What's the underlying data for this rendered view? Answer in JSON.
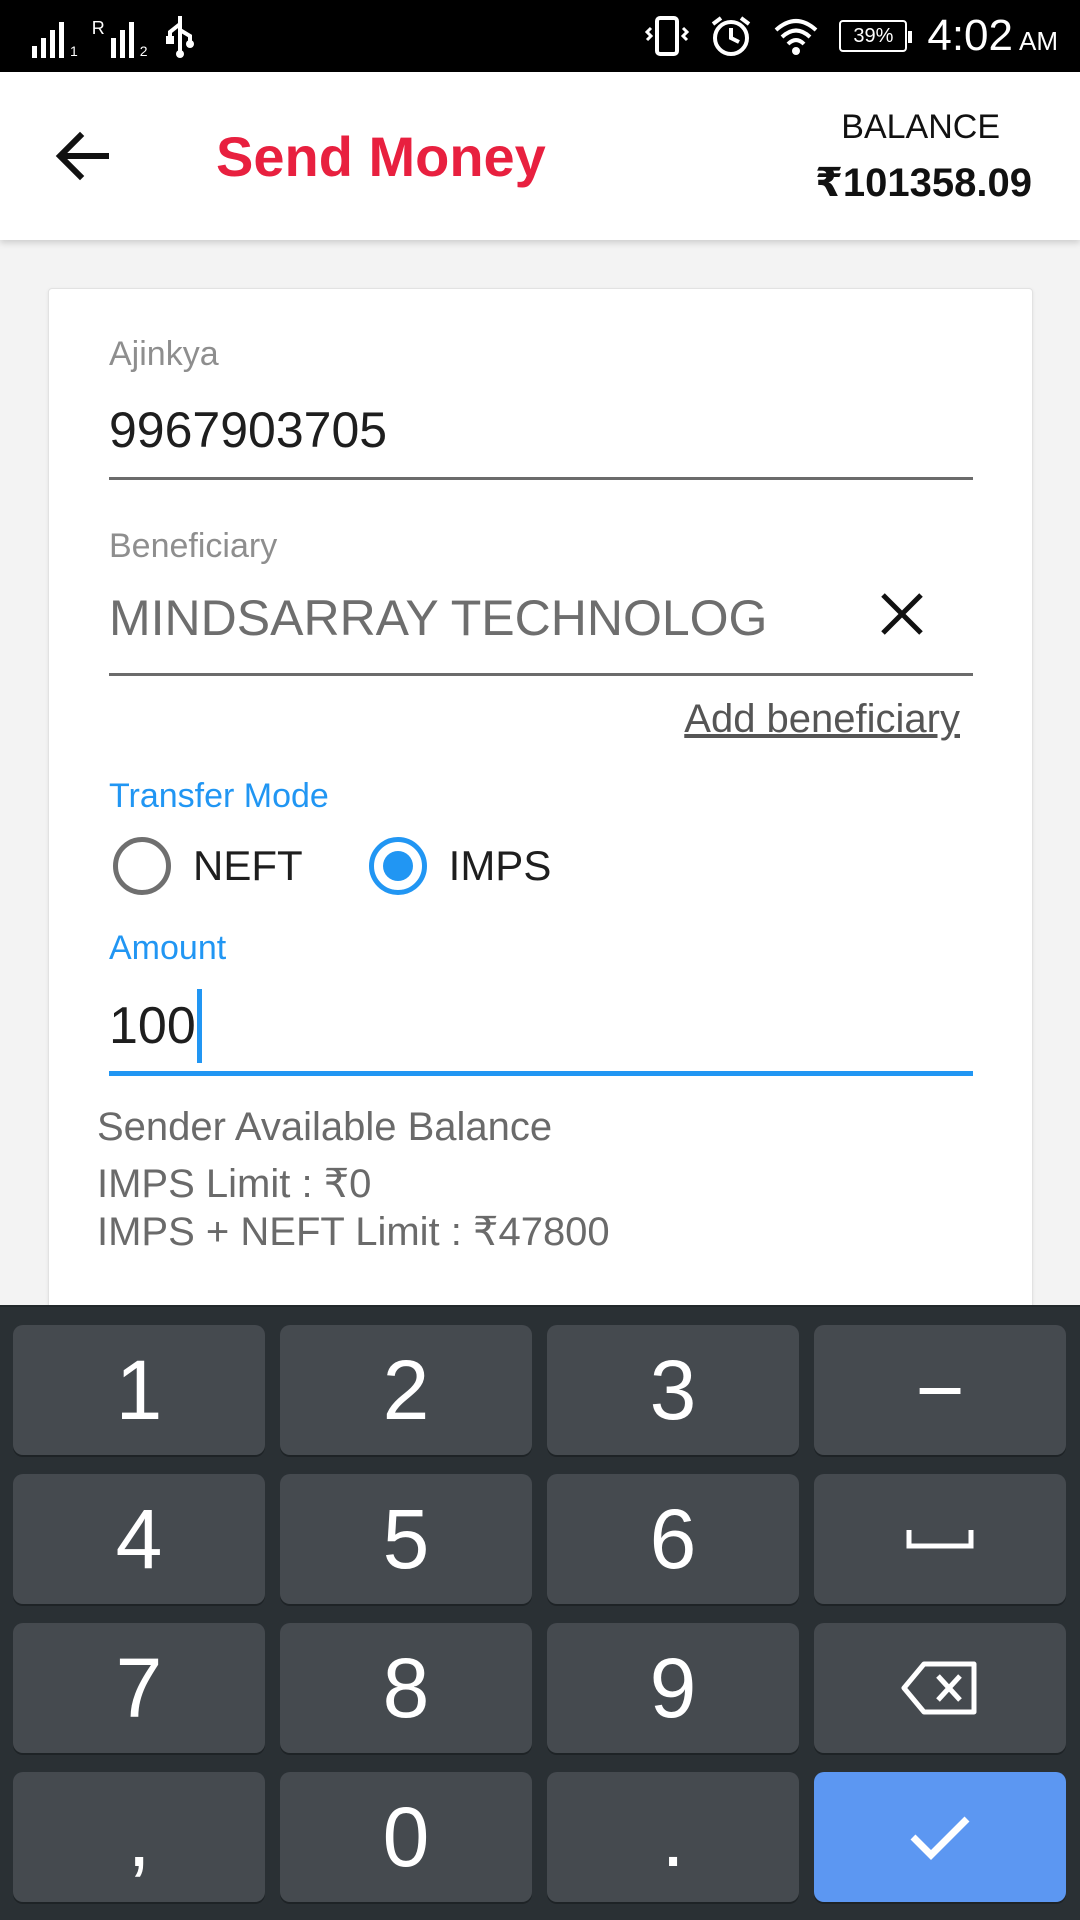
{
  "status_bar": {
    "time": "4:02",
    "ampm": "AM",
    "battery": "39%",
    "sim1_sub": "1",
    "sim2_sub": "2",
    "sim2_letter": "R",
    "icons": [
      "signal-icon",
      "usb-icon",
      "vibrate-icon",
      "alarm-icon",
      "wifi-icon",
      "battery-icon"
    ]
  },
  "app_bar": {
    "title": "Send Money",
    "balance_label": "BALANCE",
    "balance_value": "₹101358.09",
    "title_color": "#e8203f"
  },
  "form": {
    "sender_label": "Ajinkya",
    "sender_value": "9967903705",
    "beneficiary_label": "Beneficiary",
    "beneficiary_value": "MINDSARRAY TECHNOLOG",
    "add_beneficiary": "Add beneficiary",
    "transfer_mode_label": "Transfer Mode",
    "modes": [
      {
        "label": "NEFT",
        "checked": false
      },
      {
        "label": "IMPS",
        "checked": true
      }
    ],
    "amount_label": "Amount",
    "amount_value": "100",
    "accent_color": "#2196f3"
  },
  "info": {
    "line1": "Sender Available Balance",
    "line2": "IMPS Limit : ₹0",
    "line3": "IMPS + NEFT Limit : ₹47800"
  },
  "keyboard": {
    "keys": [
      "1",
      "2",
      "3",
      "−",
      "4",
      "5",
      "6",
      "",
      "7",
      "8",
      "9",
      "",
      ",",
      "0",
      ".",
      ""
    ],
    "special_icons": [
      "space-icon",
      "backspace-icon",
      "checkmark-icon"
    ]
  }
}
